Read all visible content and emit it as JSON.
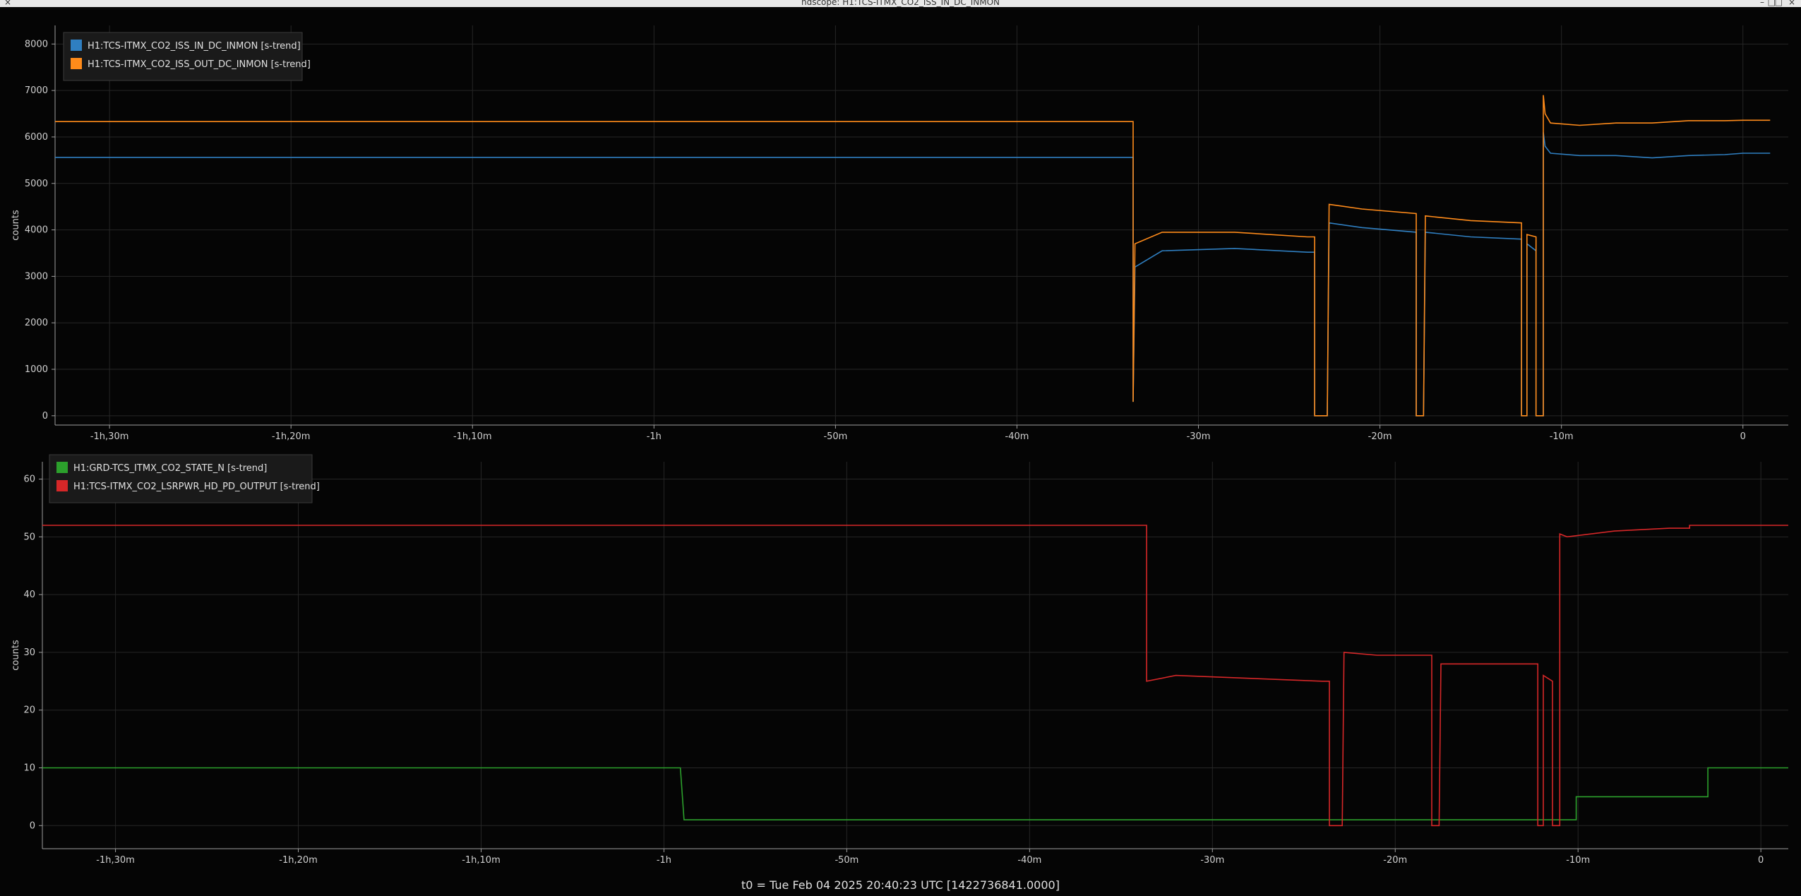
{
  "window": {
    "title": "ndscope: H1:TCS-ITMX_CO2_ISS_IN_DC_INMON",
    "buttons": [
      "×",
      "–",
      "□",
      "×"
    ]
  },
  "footer": "t0 = Tue Feb 04 2025 20:40:23 UTC [1422736841.0000]",
  "colors": {
    "background": "#050505",
    "grid": "#262626",
    "axis": "#a0a0a0",
    "blue": "#2f7fc1",
    "orange": "#ff8b1a",
    "green": "#2ca02c",
    "red": "#d62728"
  },
  "chart_data": [
    {
      "type": "line",
      "ylabel": "counts",
      "xlim": [
        -93,
        2.5
      ],
      "ylim": [
        -200,
        8400
      ],
      "x_ticks": [
        -90,
        -80,
        -70,
        -60,
        -50,
        -40,
        -30,
        -20,
        -10,
        0
      ],
      "x_tick_labels": [
        "-1h,30m",
        "-1h,20m",
        "-1h,10m",
        "-1h",
        "-50m",
        "-40m",
        "-30m",
        "-20m",
        "-10m",
        "0"
      ],
      "y_ticks": [
        0,
        1000,
        2000,
        3000,
        4000,
        5000,
        6000,
        7000,
        8000
      ],
      "grid": true,
      "legend_position": "top-left",
      "series": [
        {
          "name": "H1:TCS-ITMX_CO2_ISS_IN_DC_INMON [s-trend]",
          "color": "#2f7fc1",
          "x": [
            -93,
            -33.6,
            -33.6,
            -33.5,
            -32,
            -28,
            -24,
            -23.6,
            -23.6,
            -22.9,
            -22.9,
            -22.8,
            -21,
            -18,
            -18,
            -17.6,
            -17.6,
            -17.5,
            -15,
            -12.2,
            -12.2,
            -11.9,
            -11.9,
            -11.4,
            -11.4,
            -11.0,
            -11.0,
            -10.9,
            -10.6,
            -9,
            -7,
            -5,
            -3,
            -1,
            0,
            1.5
          ],
          "y": [
            5560,
            5560,
            300,
            3200,
            3550,
            3600,
            3520,
            3520,
            0,
            0,
            0,
            4150,
            4050,
            3950,
            0,
            0,
            0,
            3950,
            3850,
            3800,
            0,
            0,
            3700,
            3550,
            0,
            0,
            6100,
            5800,
            5650,
            5600,
            5600,
            5550,
            5600,
            5620,
            5650,
            5650
          ]
        },
        {
          "name": "H1:TCS-ITMX_CO2_ISS_OUT_DC_INMON [s-trend]",
          "color": "#ff8b1a",
          "x": [
            -93,
            -33.6,
            -33.6,
            -33.5,
            -32,
            -28,
            -24,
            -23.6,
            -23.6,
            -22.9,
            -22.9,
            -22.8,
            -21,
            -18,
            -18,
            -17.6,
            -17.6,
            -17.5,
            -15,
            -12.2,
            -12.2,
            -11.9,
            -11.9,
            -11.4,
            -11.4,
            -11.0,
            -11.0,
            -10.9,
            -10.6,
            -9,
            -7,
            -5,
            -3,
            -1,
            0,
            1.5
          ],
          "y": [
            6330,
            6330,
            300,
            3700,
            3950,
            3950,
            3850,
            3850,
            0,
            0,
            0,
            4550,
            4450,
            4350,
            0,
            0,
            0,
            4300,
            4200,
            4150,
            0,
            0,
            3900,
            3850,
            0,
            0,
            6900,
            6500,
            6300,
            6250,
            6300,
            6300,
            6350,
            6350,
            6360,
            6360
          ]
        }
      ]
    },
    {
      "type": "line",
      "ylabel": "counts",
      "xlim": [
        -94,
        1.5
      ],
      "ylim": [
        -4,
        63
      ],
      "x_ticks": [
        -90,
        -80,
        -70,
        -60,
        -50,
        -40,
        -30,
        -20,
        -10,
        0
      ],
      "x_tick_labels": [
        "-1h,30m",
        "-1h,20m",
        "-1h,10m",
        "-1h",
        "-50m",
        "-40m",
        "-30m",
        "-20m",
        "-10m",
        "0"
      ],
      "y_ticks": [
        0,
        10,
        20,
        30,
        40,
        50,
        60
      ],
      "grid": true,
      "legend_position": "top-left",
      "series": [
        {
          "name": "H1:GRD-TCS_ITMX_CO2_STATE_N [s-trend]",
          "color": "#2ca02c",
          "x": [
            -94,
            -59.1,
            -58.9,
            -10.1,
            -10.1,
            -2.9,
            -2.9,
            1.5
          ],
          "y": [
            10,
            10,
            1,
            1,
            5,
            5,
            10,
            10
          ],
          "x_frac": [
            0.0,
            0.35,
            0.352,
            0.84,
            0.84,
            0.93,
            0.93,
            1.0
          ]
        },
        {
          "name": "H1:TCS-ITMX_CO2_LSRPWR_HD_PD_OUTPUT [s-trend]",
          "color": "#d62728",
          "x": [
            -94,
            -33.6,
            -33.6,
            -32,
            -28,
            -24,
            -23.6,
            -23.6,
            -22.9,
            -22.9,
            -22.8,
            -21,
            -18,
            -18,
            -17.6,
            -17.6,
            -17.5,
            -15,
            -12.2,
            -12.2,
            -11.9,
            -11.9,
            -11.4,
            -11.4,
            -11.0,
            -11.0,
            -10.6,
            -8,
            -5,
            -3.9,
            -3.9,
            -2,
            1.5
          ],
          "y": [
            52,
            52,
            25,
            26,
            25.5,
            25,
            25,
            0,
            0,
            0,
            30,
            29.5,
            29.5,
            0,
            0,
            0,
            28,
            28,
            28,
            0,
            0,
            26,
            25,
            0,
            0,
            50.5,
            50,
            51,
            51.5,
            51.5,
            52,
            52,
            52
          ]
        }
      ]
    }
  ]
}
